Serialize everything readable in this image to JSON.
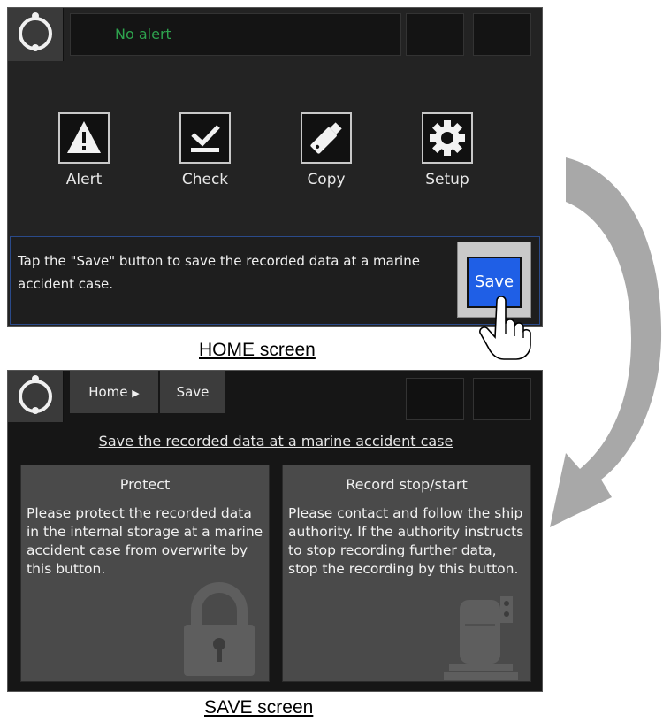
{
  "home": {
    "alert_text": "No alert",
    "menu": [
      {
        "label": "Alert",
        "icon": "warning-icon"
      },
      {
        "label": "Check",
        "icon": "check-icon"
      },
      {
        "label": "Copy",
        "icon": "usb-drive-icon"
      },
      {
        "label": "Setup",
        "icon": "gear-icon"
      }
    ],
    "message": "Tap the \"Save\" button to save the recorded data at a marine accident case.",
    "save_label": "Save",
    "caption": "HOME screen"
  },
  "save": {
    "breadcrumb_home": "Home",
    "breadcrumb_current": "Save",
    "title": "Save the recorded data at a marine accident case",
    "panels": [
      {
        "title": "Protect",
        "text": "Please protect the recorded data in the internal storage at a marine accident case from overwrite by this button.",
        "icon": "padlock-icon"
      },
      {
        "title": "Record stop/start",
        "text": "Please contact and follow the ship authority. If the authority instructs to stop recording further data, stop the recording by this button.",
        "icon": "recorder-icon"
      }
    ],
    "caption": "SAVE screen"
  },
  "colors": {
    "alert_green": "#2ea34e",
    "save_blue": "#1f5fe6",
    "arrow_gray": "#a8a8a8"
  }
}
